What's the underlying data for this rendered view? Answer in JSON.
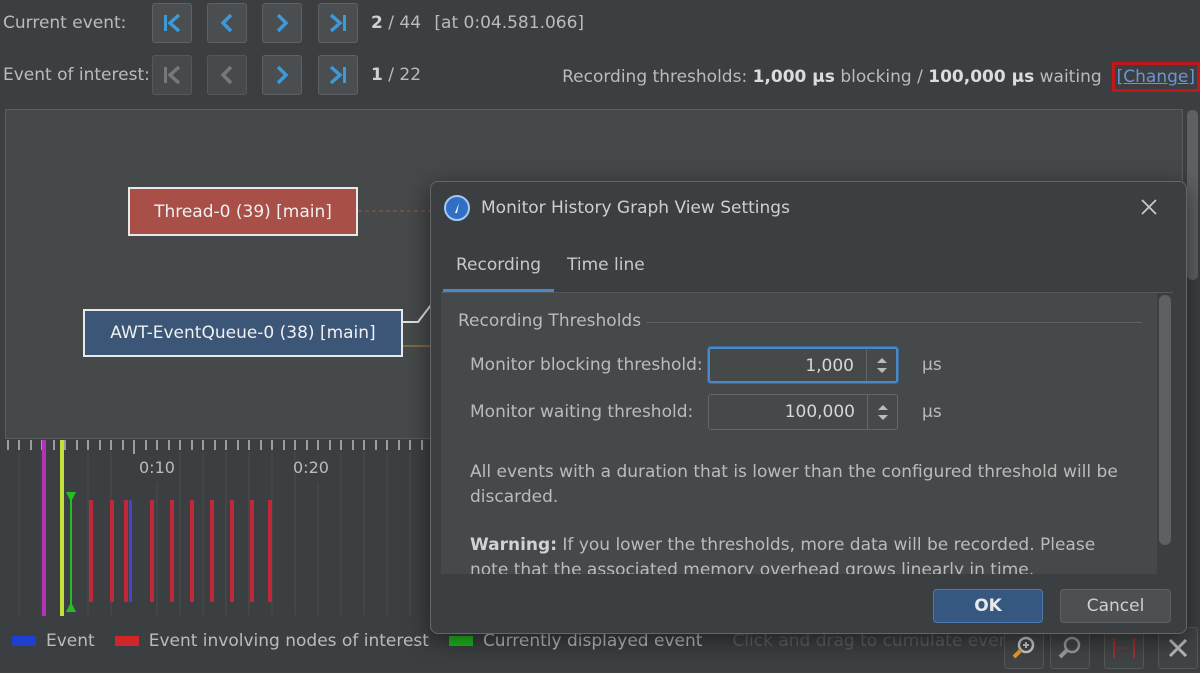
{
  "nav": {
    "current_event": {
      "label": "Current event:",
      "position": "2",
      "total": "/ 44",
      "timestamp": "[at 0:04.581.066]"
    },
    "event_of_interest": {
      "label": "Event of interest:",
      "position": "1",
      "total": "/ 22"
    }
  },
  "thresholds": {
    "label": "Recording thresholds:",
    "blocking_value": "1,000 µs",
    "blocking_text": "blocking /",
    "waiting_value": "100,000 µs",
    "waiting_text": "waiting",
    "change_link": "[Change]"
  },
  "graph": {
    "nodes": [
      {
        "label": "Thread-0 (39) [main]",
        "color": "#a84f48"
      },
      {
        "label": "AWT-EventQueue-0 (38) [main]",
        "color": "#3c5677"
      }
    ]
  },
  "timeline": {
    "tick_labels": [
      "0:10",
      "0:20"
    ]
  },
  "legend": {
    "items": [
      {
        "label": "Event",
        "color": "#1f3fd1"
      },
      {
        "label": "Event involving nodes of interest",
        "color": "#d0262a"
      },
      {
        "label": "Currently displayed event",
        "color": "#1fb81f"
      }
    ],
    "hint": "Click and drag to cumulate events"
  },
  "dialog": {
    "title": "Monitor History Graph View Settings",
    "tabs": [
      "Recording",
      "Time line"
    ],
    "active_tab": "Recording",
    "group_title": "Recording Thresholds",
    "fields": [
      {
        "label": "Monitor blocking threshold:",
        "value": "1,000",
        "unit": "µs"
      },
      {
        "label": "Monitor waiting threshold:",
        "value": "100,000",
        "unit": "µs"
      }
    ],
    "info_text": "All events with a duration that is lower than the configured threshold will be discarded.",
    "warning_label": "Warning:",
    "warning_text": "If you lower the thresholds, more data will be recorded. Please note that the associated memory overhead grows linearly in time.",
    "ok_label": "OK",
    "cancel_label": "Cancel"
  },
  "colors": {
    "accent": "#4a88c7",
    "node_red": "#a84f48",
    "node_blue": "#3c5677",
    "change_highlight": "#c0181a"
  }
}
